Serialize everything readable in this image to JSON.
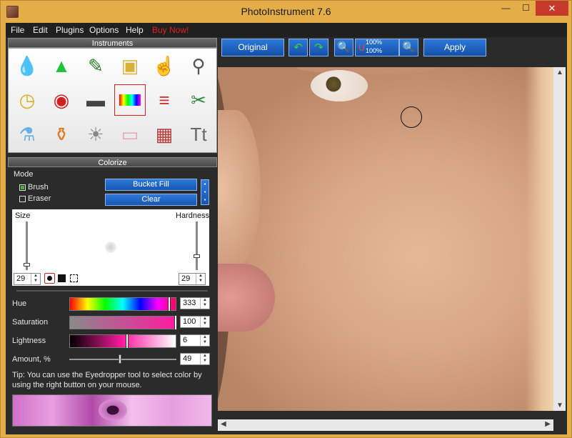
{
  "window": {
    "title": "PhotoInstrument 7.6",
    "min": "—",
    "max": "☐",
    "close": "✕"
  },
  "menu": {
    "items": [
      "File",
      "Edit",
      "Plugins",
      "Options",
      "Help"
    ],
    "buy": "Buy Now!",
    "buy_color": "#e02020"
  },
  "instruments": {
    "title": "Instruments",
    "tools": [
      {
        "icon": "water-drop-icon",
        "glyph": "💧"
      },
      {
        "icon": "cone-icon",
        "glyph": "▲"
      },
      {
        "icon": "pencils-icon",
        "glyph": "✎"
      },
      {
        "icon": "stamp-icon",
        "glyph": "▣"
      },
      {
        "icon": "finger-icon",
        "glyph": "☝"
      },
      {
        "icon": "pin-icon",
        "glyph": "⚲"
      },
      {
        "icon": "clock-icon",
        "glyph": "◷"
      },
      {
        "icon": "eye-icon",
        "glyph": "◉"
      },
      {
        "icon": "gradient-icon",
        "glyph": "▬"
      },
      {
        "icon": "rainbow-icon",
        "glyph": "▤"
      },
      {
        "icon": "lines-icon",
        "glyph": "≡"
      },
      {
        "icon": "scissors-icon",
        "glyph": "✂"
      },
      {
        "icon": "test-tube-icon",
        "glyph": "⚗"
      },
      {
        "icon": "bottle-icon",
        "glyph": "⚱"
      },
      {
        "icon": "lamp-icon",
        "glyph": "☀"
      },
      {
        "icon": "eraser-icon",
        "glyph": "▭"
      },
      {
        "icon": "tv-icon",
        "glyph": "▦"
      },
      {
        "icon": "text-layers-icon",
        "glyph": "Tt"
      }
    ],
    "selected_index": 9
  },
  "colorize": {
    "title": "Colorize",
    "mode_label": "Mode",
    "brush": "Brush",
    "eraser": "Eraser",
    "bucket_fill": "Bucket Fill",
    "clear": "Clear",
    "size_label": "Size",
    "hardness_label": "Hardness",
    "size_value": "29",
    "hardness_value": "29",
    "hue_label": "Hue",
    "hue_value": "333",
    "saturation_label": "Saturation",
    "saturation_value": "100",
    "lightness_label": "Lightness",
    "lightness_value": "6",
    "amount_label": "Amount, %",
    "amount_value": "49",
    "tip": "Tip: You can use the Eyedropper tool to select color by using the right button on your mouse."
  },
  "toolbar": {
    "original": "Original",
    "apply": "Apply",
    "zoom_top": "100%",
    "zoom_bottom": "100%"
  },
  "colors": {
    "accent": "#1a62c4",
    "panel_bg": "#2d2d2d",
    "frame": "#e4ad47"
  }
}
